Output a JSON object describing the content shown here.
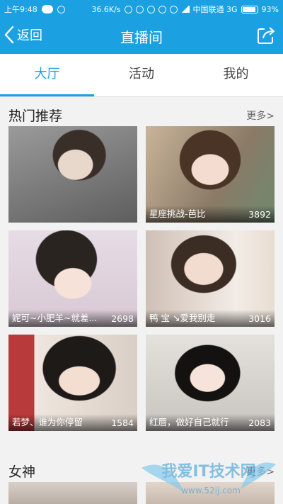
{
  "status_bar": {
    "time": "上午9:48",
    "speed": "36.6K/s",
    "carrier": "中国联通 3G",
    "battery": "93%"
  },
  "nav": {
    "back_label": "返回",
    "title": "直播间"
  },
  "tabs": [
    {
      "label": "大厅",
      "active": true
    },
    {
      "label": "活动",
      "active": false
    },
    {
      "label": "我的",
      "active": false
    }
  ],
  "sections": {
    "hot": {
      "title": "热门推荐",
      "more": "更多>"
    },
    "goddess": {
      "title": "女神",
      "more": "更多>"
    }
  },
  "hot_cards": [
    {
      "name": "",
      "count": ""
    },
    {
      "name": "星座挑战-芭比",
      "count": "3892"
    },
    {
      "name": "妮可~小肥羊~就差...",
      "count": "2698"
    },
    {
      "name": "鸭 宝 ↘爱我别走",
      "count": "3016"
    },
    {
      "name": "若梦、谁为你停留",
      "count": "1584"
    },
    {
      "name": "红唇，做好自己就行",
      "count": "2083"
    }
  ],
  "watermark": {
    "text": "我爱IT技术网",
    "url": "www.52ij.com"
  },
  "colors": {
    "accent": "#1ba1e2",
    "background": "#f2f2f2"
  }
}
